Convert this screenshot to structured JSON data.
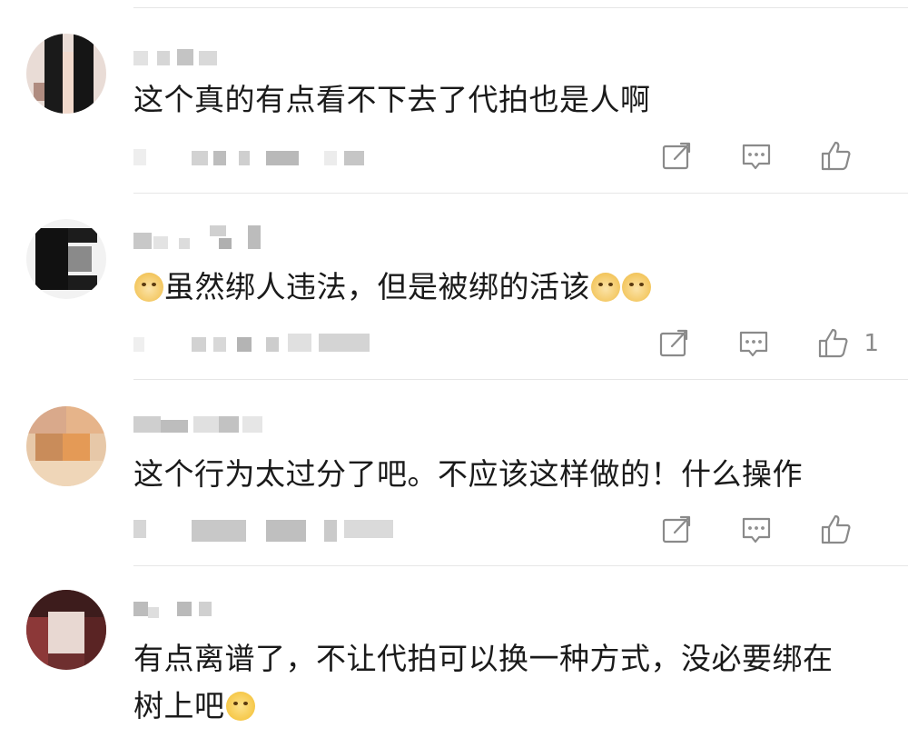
{
  "comments": [
    {
      "text": "这个真的有点看不下去了代拍也是人啊",
      "emoji_before": [],
      "emoji_after": [],
      "like_count": "",
      "actions": {
        "share_icon": "share-icon",
        "reply_icon": "comment-icon",
        "like_icon": "thumbs-up-icon"
      }
    },
    {
      "text": "虽然绑人违法，但是被绑的活该",
      "emoji_before": [
        "doge-emoji"
      ],
      "emoji_after": [
        "doge-emoji",
        "doge-emoji"
      ],
      "like_count": "1",
      "actions": {
        "share_icon": "share-icon",
        "reply_icon": "comment-icon",
        "like_icon": "thumbs-up-icon"
      }
    },
    {
      "text": "这个行为太过分了吧。不应该这样做的！什么操作",
      "emoji_before": [],
      "emoji_after": [],
      "like_count": "",
      "actions": {
        "share_icon": "share-icon",
        "reply_icon": "comment-icon",
        "like_icon": "thumbs-up-icon"
      }
    },
    {
      "text_line1": "有点离谱了，不让代拍可以换一种方式，没必要绑在",
      "text_line2": "树上吧",
      "emoji_after": [
        "smirk-emoji"
      ],
      "like_count": ""
    }
  ],
  "colors": {
    "text": "#1a1a1a",
    "icon": "#8a8a8a",
    "divider": "#e6e6e6"
  }
}
